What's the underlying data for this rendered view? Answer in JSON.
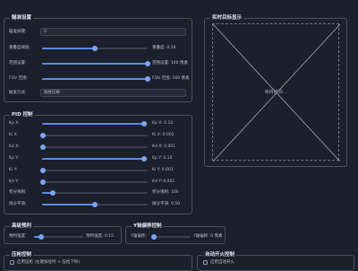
{
  "aim_settings": {
    "title": "瞄准设置",
    "key_label": "瞄准按键:",
    "key_value": "0",
    "overlap_label": "重叠度阈值:",
    "overlap_value": "重叠度: 0.30",
    "overlap_fraction": 0.5,
    "fov_label": "范围设置:",
    "fov_value": "范围设置: 160 像素",
    "fov_fraction": 1.0,
    "fovdisp_label": "FOV 范围:",
    "fovdisp_value": "FOV 范围: 160 像素",
    "fovdisp_fraction": 1.0,
    "mode_label": "触发方式:",
    "mode_value": "按住切换"
  },
  "preview": {
    "title": "实时目标显示",
    "placeholder": "等待检测..."
  },
  "pid": {
    "title": "PID 控制",
    "rows": [
      {
        "label": "Kp X:",
        "value": "Kp X: 0.10",
        "fraction": 0.97
      },
      {
        "label": "Ki X:",
        "value": "Ki X: 0.001",
        "fraction": 0.01
      },
      {
        "label": "Kd X:",
        "value": "Kd X: 0.001",
        "fraction": 0.01
      },
      {
        "label": "Kp Y:",
        "value": "Kp Y: 0.10",
        "fraction": 0.97
      },
      {
        "label": "Ki Y:",
        "value": "Ki Y: 0.001",
        "fraction": 0.01
      },
      {
        "label": "Kd Y:",
        "value": "Kd Y: 0.001",
        "fraction": 0.01
      },
      {
        "label": "积分限制:",
        "value": "积分限制: 100",
        "fraction": 0.1
      },
      {
        "label": "微分平滑:",
        "value": "微分平滑: 0.50",
        "fraction": 0.5
      }
    ]
  },
  "prediction": {
    "title": "高级预判",
    "label": "预判强度:",
    "value": "预判强度: 0.15",
    "fraction": 0.15
  },
  "y_offset": {
    "title": "Y轴偏移控制",
    "label": "Y轴偏移:",
    "value": "Y轴偏移: 0 像素",
    "fraction": 0.02
  },
  "recoil": {
    "title": "压枪控制",
    "checkbox_label": "启用压枪 (左键按住时 + 压枪下移)"
  },
  "auto_fire": {
    "title": "自动开火控制",
    "checkbox_label": "启用自动开火"
  }
}
